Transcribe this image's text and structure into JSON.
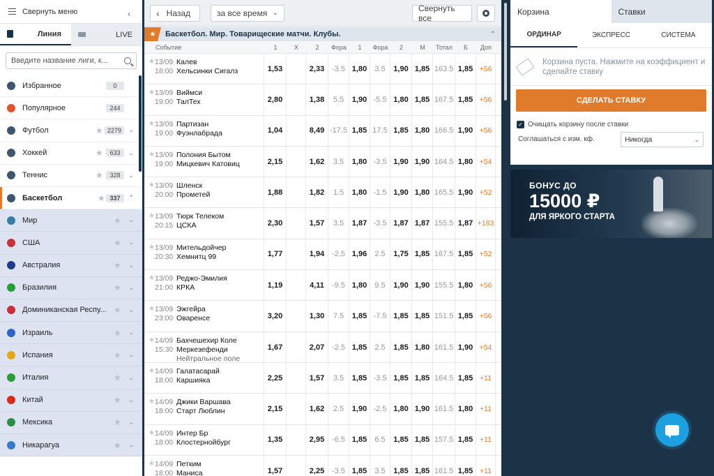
{
  "sidebar": {
    "collapse_label": "Свернуть меню",
    "tab_line": "Линия",
    "tab_live": "LIVE",
    "search_placeholder": "Введите название лиги, к...",
    "sports": [
      {
        "label": "Избранное",
        "count": "0",
        "color": "#3f5670",
        "has_star": false
      },
      {
        "label": "Популярное",
        "count": "244",
        "color": "#e0542c",
        "has_star": false
      },
      {
        "label": "Футбол",
        "count": "2279",
        "color": "#3f5670",
        "has_star": true
      },
      {
        "label": "Хоккей",
        "count": "633",
        "color": "#3f5670",
        "has_star": true
      },
      {
        "label": "Теннис",
        "count": "328",
        "color": "#3f5670",
        "has_star": true
      },
      {
        "label": "Баскетбол",
        "count": "337",
        "color": "#3f5670",
        "has_star": true
      }
    ],
    "countries": [
      {
        "label": "Мир",
        "flag": "#3a7ca5"
      },
      {
        "label": "США",
        "flag": "#c9303a"
      },
      {
        "label": "Австралия",
        "flag": "#1f3c8c"
      },
      {
        "label": "Бразилия",
        "flag": "#2a9d3a"
      },
      {
        "label": "Доминиканская Респу...",
        "flag": "#c9303a"
      },
      {
        "label": "Израиль",
        "flag": "#2f63c8"
      },
      {
        "label": "Испания",
        "flag": "#e2a81a"
      },
      {
        "label": "Италия",
        "flag": "#2a9d3a"
      },
      {
        "label": "Китай",
        "flag": "#d92a1c"
      },
      {
        "label": "Мексика",
        "flag": "#2a8d4a"
      },
      {
        "label": "Никарагуа",
        "flag": "#3a79c8"
      }
    ]
  },
  "toolbar": {
    "back_label": "Назад",
    "period_label": "за все время",
    "collapse_all_label": "Свернуть все"
  },
  "league": {
    "title": "Баскетбол. Мир. Товарищеские матчи. Клубы."
  },
  "columns": [
    "Событие",
    "1",
    "X",
    "2",
    "Фора",
    "1",
    "Фора",
    "2",
    "М",
    "Тотал",
    "Б",
    "Доп"
  ],
  "events": [
    {
      "date": "13/09",
      "time": "18:00",
      "team1": "Калев",
      "team2": "Хельсинки Сигалз",
      "note": "",
      "c1": "1,53",
      "cx": "",
      "c2": "2,33",
      "h1": "-3.5",
      "hc1": "1,80",
      "h2": "3.5",
      "hc2": "1,90",
      "m": "1,85",
      "total": "163.5",
      "b": "1,85",
      "more": "+56"
    },
    {
      "date": "13/09",
      "time": "19:00",
      "team1": "Виймси",
      "team2": "ТалТех",
      "note": "",
      "c1": "2,80",
      "cx": "",
      "c2": "1,38",
      "h1": "5.5",
      "hc1": "1,90",
      "h2": "-5.5",
      "hc2": "1,80",
      "m": "1,85",
      "total": "167.5",
      "b": "1,85",
      "more": "+56"
    },
    {
      "date": "13/09",
      "time": "19:00",
      "team1": "Партизан",
      "team2": "Фуэнлабрада",
      "note": "",
      "c1": "1,04",
      "cx": "",
      "c2": "8,49",
      "h1": "-17.5",
      "hc1": "1,85",
      "h2": "17.5",
      "hc2": "1,85",
      "m": "1,80",
      "total": "166.5",
      "b": "1,90",
      "more": "+56"
    },
    {
      "date": "13/09",
      "time": "19:00",
      "team1": "Полония Бытом",
      "team2": "Мицкевич Катовиц",
      "note": "",
      "c1": "2,15",
      "cx": "",
      "c2": "1,62",
      "h1": "3.5",
      "hc1": "1,80",
      "h2": "-3.5",
      "hc2": "1,90",
      "m": "1,90",
      "total": "164.5",
      "b": "1,80",
      "more": "+54"
    },
    {
      "date": "13/09",
      "time": "20:00",
      "team1": "Шленск",
      "team2": "Прометей",
      "note": "",
      "c1": "1,88",
      "cx": "",
      "c2": "1,82",
      "h1": "1.5",
      "hc1": "1,80",
      "h2": "-1.5",
      "hc2": "1,90",
      "m": "1,80",
      "total": "165.5",
      "b": "1,90",
      "more": "+52"
    },
    {
      "date": "13/09",
      "time": "20:15",
      "team1": "Тюрк Телеком",
      "team2": "ЦСКА",
      "note": "",
      "c1": "2,30",
      "cx": "",
      "c2": "1,57",
      "h1": "3.5",
      "hc1": "1,87",
      "h2": "-3.5",
      "hc2": "1,87",
      "m": "1,87",
      "total": "155.5",
      "b": "1,87",
      "more": "+183"
    },
    {
      "date": "13/09",
      "time": "20:30",
      "team1": "Мительдойчер",
      "team2": "Хемнитц 99",
      "note": "",
      "c1": "1,77",
      "cx": "",
      "c2": "1,94",
      "h1": "-2.5",
      "hc1": "1,96",
      "h2": "2.5",
      "hc2": "1,75",
      "m": "1,85",
      "total": "167.5",
      "b": "1,85",
      "more": "+52"
    },
    {
      "date": "13/09",
      "time": "21:00",
      "team1": "Реджо-Эмилия",
      "team2": "КРКА",
      "note": "",
      "c1": "1,19",
      "cx": "",
      "c2": "4,11",
      "h1": "-9.5",
      "hc1": "1,80",
      "h2": "9.5",
      "hc2": "1,90",
      "m": "1,90",
      "total": "155.5",
      "b": "1,80",
      "more": "+56"
    },
    {
      "date": "13/09",
      "time": "23:00",
      "team1": "Эжгейра",
      "team2": "Оваренсе",
      "note": "",
      "c1": "3,20",
      "cx": "",
      "c2": "1,30",
      "h1": "7.5",
      "hc1": "1,85",
      "h2": "-7.5",
      "hc2": "1,85",
      "m": "1,85",
      "total": "151.5",
      "b": "1,85",
      "more": "+56"
    },
    {
      "date": "14/09",
      "time": "15:30",
      "team1": "Бахчешехир Коле",
      "team2": "Меркезефенди",
      "note": "Нейтральное поле",
      "c1": "1,67",
      "cx": "",
      "c2": "2,07",
      "h1": "-2.5",
      "hc1": "1,85",
      "h2": "2.5",
      "hc2": "1,85",
      "m": "1,80",
      "total": "161.5",
      "b": "1,90",
      "more": "+54"
    },
    {
      "date": "14/09",
      "time": "18:00",
      "team1": "Галатасарай",
      "team2": "Каршияка",
      "note": "",
      "c1": "2,25",
      "cx": "",
      "c2": "1,57",
      "h1": "3.5",
      "hc1": "1,85",
      "h2": "-3.5",
      "hc2": "1,85",
      "m": "1,85",
      "total": "164.5",
      "b": "1,85",
      "more": "+11"
    },
    {
      "date": "14/09",
      "time": "18:00",
      "team1": "Джики Варшава",
      "team2": "Старт Люблин",
      "note": "",
      "c1": "2,15",
      "cx": "",
      "c2": "1,62",
      "h1": "2.5",
      "hc1": "1,90",
      "h2": "-2.5",
      "hc2": "1,80",
      "m": "1,90",
      "total": "161.5",
      "b": "1,80",
      "more": "+11"
    },
    {
      "date": "14/09",
      "time": "18:00",
      "team1": "Интер Бр",
      "team2": "Клостернойбург",
      "note": "",
      "c1": "1,35",
      "cx": "",
      "c2": "2,95",
      "h1": "-6.5",
      "hc1": "1,85",
      "h2": "6.5",
      "hc2": "1,85",
      "m": "1,85",
      "total": "157.5",
      "b": "1,85",
      "more": "+11"
    },
    {
      "date": "14/09",
      "time": "18:00",
      "team1": "Петким",
      "team2": "Маниса",
      "note": "",
      "c1": "1,57",
      "cx": "",
      "c2": "2,25",
      "h1": "-3.5",
      "hc1": "1,85",
      "h2": "3.5",
      "hc2": "1,85",
      "m": "1,85",
      "total": "161.5",
      "b": "1,85",
      "more": "+11"
    }
  ],
  "betslip": {
    "tab_basket": "Корзина",
    "tab_bets": "Ставки",
    "mode_single": "ОРДИНАР",
    "mode_express": "ЭКСПРЕСС",
    "mode_system": "СИСТЕМА",
    "empty_text": "Корзина пуста. Нажмите на коэффициент и сделайте ставку",
    "bet_button": "СДЕЛАТЬ СТАВКУ",
    "clear_label": "Очищать корзину после ставки",
    "clear_checked": true,
    "accept_label": "Соглашаться с изм. кф.",
    "accept_value": "Никогда"
  },
  "banner": {
    "line1": "БОНУС ДО",
    "line2": "15000 ₽",
    "line3": "ДЛЯ ЯРКОГО СТАРТА"
  },
  "colors": {
    "accent": "#e07b2c",
    "navy": "#1c3247",
    "chat": "#1e9fe0"
  }
}
